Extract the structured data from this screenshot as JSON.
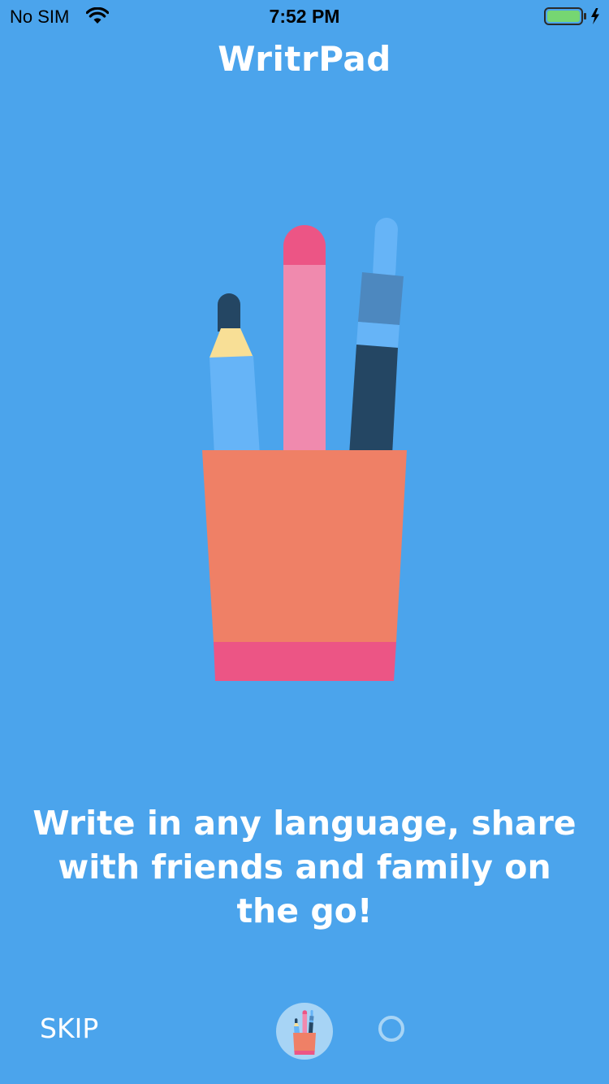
{
  "status_bar": {
    "carrier": "No SIM",
    "time": "7:52 PM",
    "battery_color": "#76D672"
  },
  "app": {
    "title": "WritrPad"
  },
  "onboarding": {
    "tagline": "Write in any language, share with friends and family on the go!",
    "skip_label": "SKIP",
    "page_count": 2,
    "current_page": 1,
    "illustration_icon": "pen-cup-icon"
  },
  "colors": {
    "background": "#4BA4EC",
    "cup": "#EF8066",
    "cup_band": "#EC5585",
    "pencil_pink": "#F08AAE",
    "pencil_tip": "#EC5585",
    "marker_blue": "#66B4F7",
    "marker_cap": "#244663",
    "marker_band": "#F8DF96",
    "pen_body": "#244663",
    "pen_grip": "#4D88BF",
    "indicator": "#A7D4F5"
  }
}
